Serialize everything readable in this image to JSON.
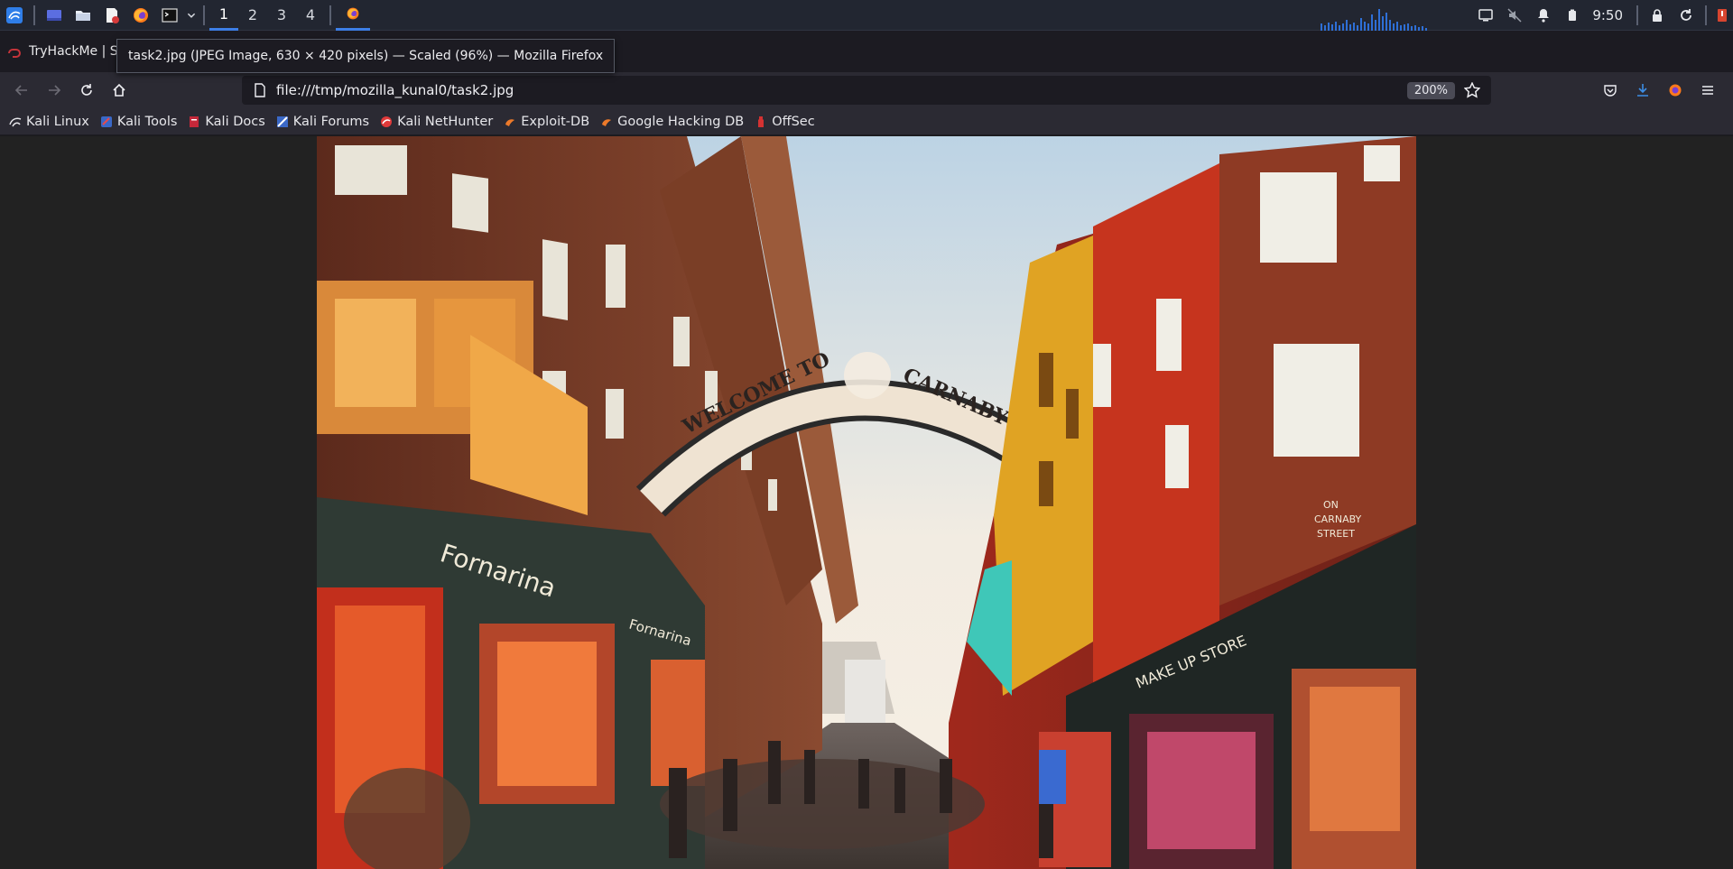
{
  "panel": {
    "workspaces": [
      "1",
      "2",
      "3",
      "4"
    ],
    "active_workspace": "1",
    "clock": "9:50"
  },
  "browser": {
    "tab_title": "TryHackMe | Se",
    "tooltip": "task2.jpg (JPEG Image, 630 × 420 pixels) — Scaled (96%) — Mozilla Firefox",
    "url": "file:///tmp/mozilla_kunal0/task2.jpg",
    "zoom_level": "200%"
  },
  "bookmarks": [
    {
      "label": "Kali Linux",
      "icon": "kali-dragon-icon"
    },
    {
      "label": "Kali Tools",
      "icon": "kali-tools-icon"
    },
    {
      "label": "Kali Docs",
      "icon": "kali-docs-icon"
    },
    {
      "label": "Kali Forums",
      "icon": "kali-forums-icon"
    },
    {
      "label": "Kali NetHunter",
      "icon": "nethunter-icon"
    },
    {
      "label": "Exploit-DB",
      "icon": "exploit-db-icon"
    },
    {
      "label": "Google Hacking DB",
      "icon": "ghdb-icon"
    },
    {
      "label": "OffSec",
      "icon": "offsec-icon"
    }
  ],
  "image": {
    "arch_left": "WELCOME TO",
    "arch_right": "CARNABY STREET",
    "shop_left": "Fornarina",
    "shop_left_small": "Fornarina",
    "shop_right": "MAKE UP STORE",
    "sign_right_1": "ON",
    "sign_right_2": "CARNABY",
    "sign_right_3": "STREET"
  },
  "colors": {
    "accent": "#3d7ee6",
    "panel_bg": "#222631",
    "toolbar_bg": "#2b2a33"
  }
}
